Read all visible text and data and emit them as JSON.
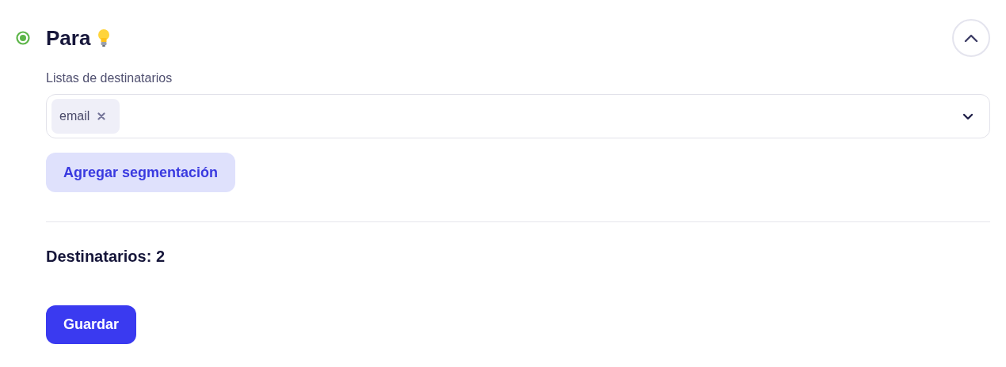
{
  "section": {
    "title": "Para",
    "expanded": true
  },
  "recipients": {
    "label": "Listas de destinatarios",
    "chips": [
      {
        "label": "email"
      }
    ]
  },
  "add_segment_button": "Agregar segmentación",
  "recipient_count": "Destinatarios: 2",
  "save_button": "Guardar"
}
